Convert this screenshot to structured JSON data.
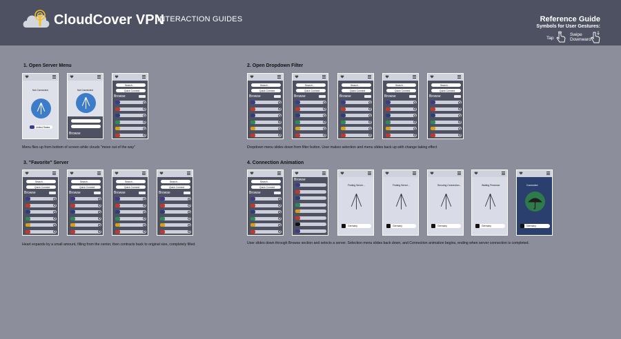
{
  "header": {
    "brand": "CloudCover VPN",
    "subtitle": "INTERACTION GUIDES",
    "reference_title": "Reference Guide",
    "reference_subtitle": "Symbols for User Gestures:",
    "gestures": [
      {
        "label": "Tap",
        "icon": "tap-hand-icon"
      },
      {
        "label": "Swipe\nDownward",
        "icon": "swipe-down-hand-icon"
      }
    ]
  },
  "colors": {
    "header_bg": "#4e5161",
    "page_bg": "#8c8e9b",
    "phone_body": "#4e5161",
    "accent_blue": "#3d7cc9",
    "connected_green": "#2f7a4a"
  },
  "sections": [
    {
      "title": "1. Open Server Menu",
      "caption": "Menu flies up from bottom of screen while clouds \"move out of the way\""
    },
    {
      "title": "2. Open Dropdown Filter",
      "caption": "Dropdown menu slides down from filter button. User makes selection and menu slides back up with change taking effect"
    },
    {
      "title": "3. \"Favorite\" Server",
      "caption": "Heart expands by a small amount, filling from the center, then contracts back to original size, completely filled."
    },
    {
      "title": "4. Connection Animation",
      "caption": "User slides down through Browse section and selects a server. Selection menu slides back down, and Connection animation begins, ending when server connection is completed."
    }
  ],
  "phone_text": {
    "not_connected": "Not Connected",
    "search": "Search...",
    "quick_connect": "Quick Connect",
    "browse": "Browse",
    "finding_server": "Finding Server...",
    "securing": "Securing Connection...",
    "waiting": "Waiting Presence",
    "connected": "Connected",
    "germany": "Germany",
    "united_states": "United States"
  }
}
